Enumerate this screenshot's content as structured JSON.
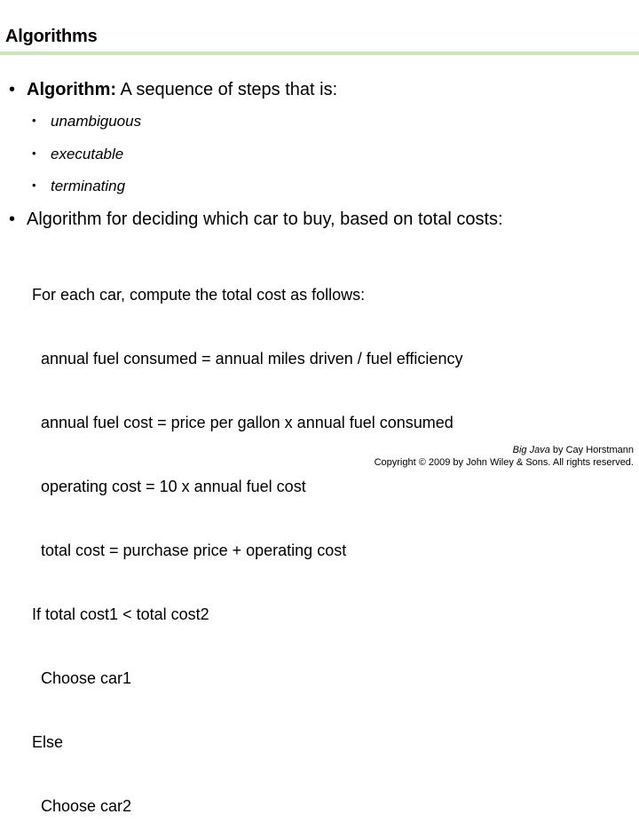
{
  "slide": {
    "title": "Algorithms",
    "bullets": [
      {
        "bold": "Algorithm:",
        "text": " A sequence of steps that is:"
      },
      {
        "bold": "",
        "text": "Algorithm for deciding which car to buy, based on total costs:"
      }
    ],
    "sub_bullets": [
      "unambiguous",
      "executable",
      "terminating"
    ],
    "pseudocode": [
      "For each car, compute the total cost as follows:",
      "  annual fuel consumed = annual miles driven / fuel efficiency",
      "  annual fuel cost = price per gallon x annual fuel consumed",
      "  operating cost = 10 x annual fuel cost",
      "  total cost = purchase price + operating cost",
      "If total cost1 < total cost2",
      "  Choose car1",
      "Else",
      "  Choose car2"
    ],
    "bullet_glyph": "•"
  },
  "footer": {
    "book": "Big Java",
    "author_text": " by Cay Horstmann",
    "copyright": "Copyright © 2009 by John Wiley & Sons.  All rights reserved."
  }
}
